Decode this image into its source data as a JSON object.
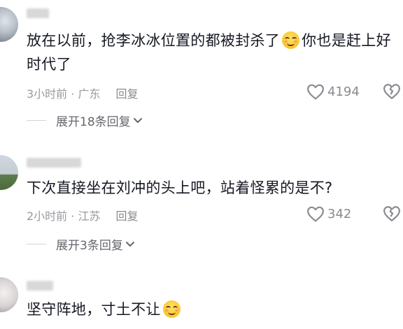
{
  "comments": [
    {
      "text_before_emoji": "放在以前，抢李冰冰位置的都被封杀了",
      "emoji": "smile-emoji",
      "text_after_emoji": "你也是赶上好时代了",
      "time": "3小时前 · 广东",
      "reply_label": "回复",
      "likes": "4194",
      "expand_label": "展开18条回复"
    },
    {
      "text": "下次直接坐在刘冲的头上吧，站着怪累的是不?",
      "time": "2小时前 · 江苏",
      "reply_label": "回复",
      "likes": "342",
      "expand_label": "展开3条回复"
    },
    {
      "text_before_emoji": "坚守阵地，寸土不让",
      "emoji": "smile-emoji"
    }
  ],
  "colors": {
    "text": "#161823",
    "meta": "#9a9aa0",
    "icon": "#8a8a90"
  }
}
